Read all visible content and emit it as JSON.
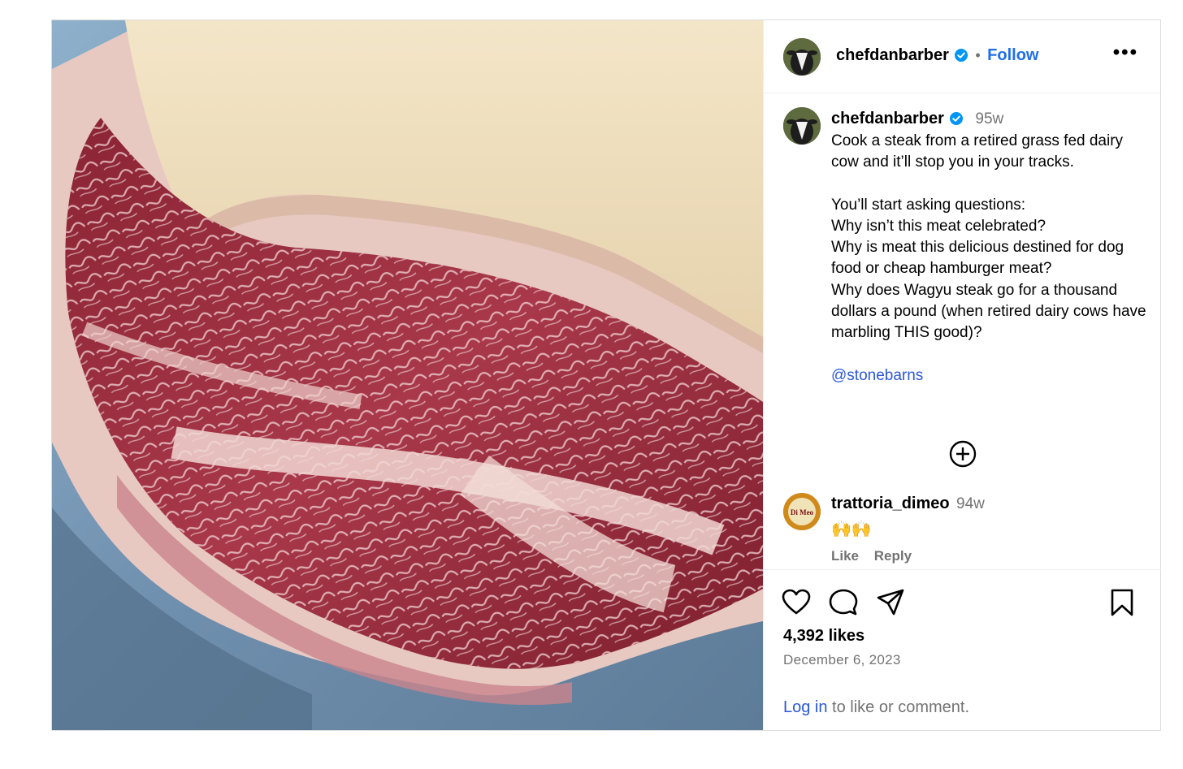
{
  "post": {
    "username": "chefdanbarber",
    "follow_label": "Follow",
    "separator": "•",
    "more_label": "•••",
    "caption": {
      "username": "chefdanbarber",
      "time": "95w",
      "line1": "Cook a steak from a retired grass fed dairy cow and it’ll stop you in your tracks.",
      "line2": "You’ll start asking questions:",
      "line3": "Why isn’t this meat celebrated?",
      "line4": "Why is meat this delicious destined for dog food or cheap hamburger meat?",
      "line5": "Why does Wagyu steak go for a thousand dollars a pound (when retired dairy cows have marbling THIS good)?",
      "mention": "@stonebarns"
    },
    "comment": {
      "username": "trattoria_dimeo",
      "time": "94w",
      "text": "🙌🙌",
      "like_label": "Like",
      "reply_label": "Reply",
      "avatar_text": "Trattoria Di Meo"
    },
    "likes": "4,392 likes",
    "date": "December 6, 2023",
    "login_link": "Log in",
    "login_rest": " to like or comment."
  },
  "colors": {
    "link": "#2b57d6",
    "verified": "#0095f6",
    "muted": "#737373",
    "border": "#dbdbdb"
  },
  "icons": [
    "verified-badge-icon",
    "more-options-icon",
    "add-circle-icon",
    "heart-icon",
    "comment-icon",
    "share-icon",
    "bookmark-icon"
  ]
}
